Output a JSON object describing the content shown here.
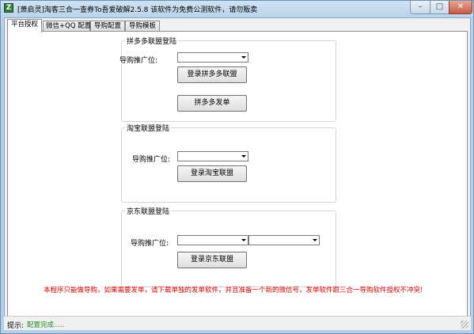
{
  "window": {
    "title": "[萧启灵]淘客三合一查券To吾爱破解2.5.8  该软件为免费公测软件，请勿贩卖",
    "icon_glyph": "Z"
  },
  "tabs": [
    "平台授权",
    "微信+QQ 配置",
    "导购配置",
    "导购模板"
  ],
  "pdd": {
    "title": "拼多多联盟登陆",
    "promo_label": "导购推广位:",
    "login_button": "登录拼多多联盟",
    "order_button": "拼多多发单"
  },
  "taobao": {
    "title": "淘宝联盟登陆",
    "promo_label": "导购推广位:",
    "login_button": "登录淘宝联盟"
  },
  "jd": {
    "title": "京东联盟登陆",
    "promo_label": "导购推广位:",
    "login_button": "登录京东联盟"
  },
  "notice": "本程序只能做导购，如果需要发单，请下载单独的发单软件，并且准备一个新的微信号，发单软件跟三合一导购软件授权不冲突!",
  "status": {
    "label": "提示:",
    "text": "配置完成....."
  }
}
